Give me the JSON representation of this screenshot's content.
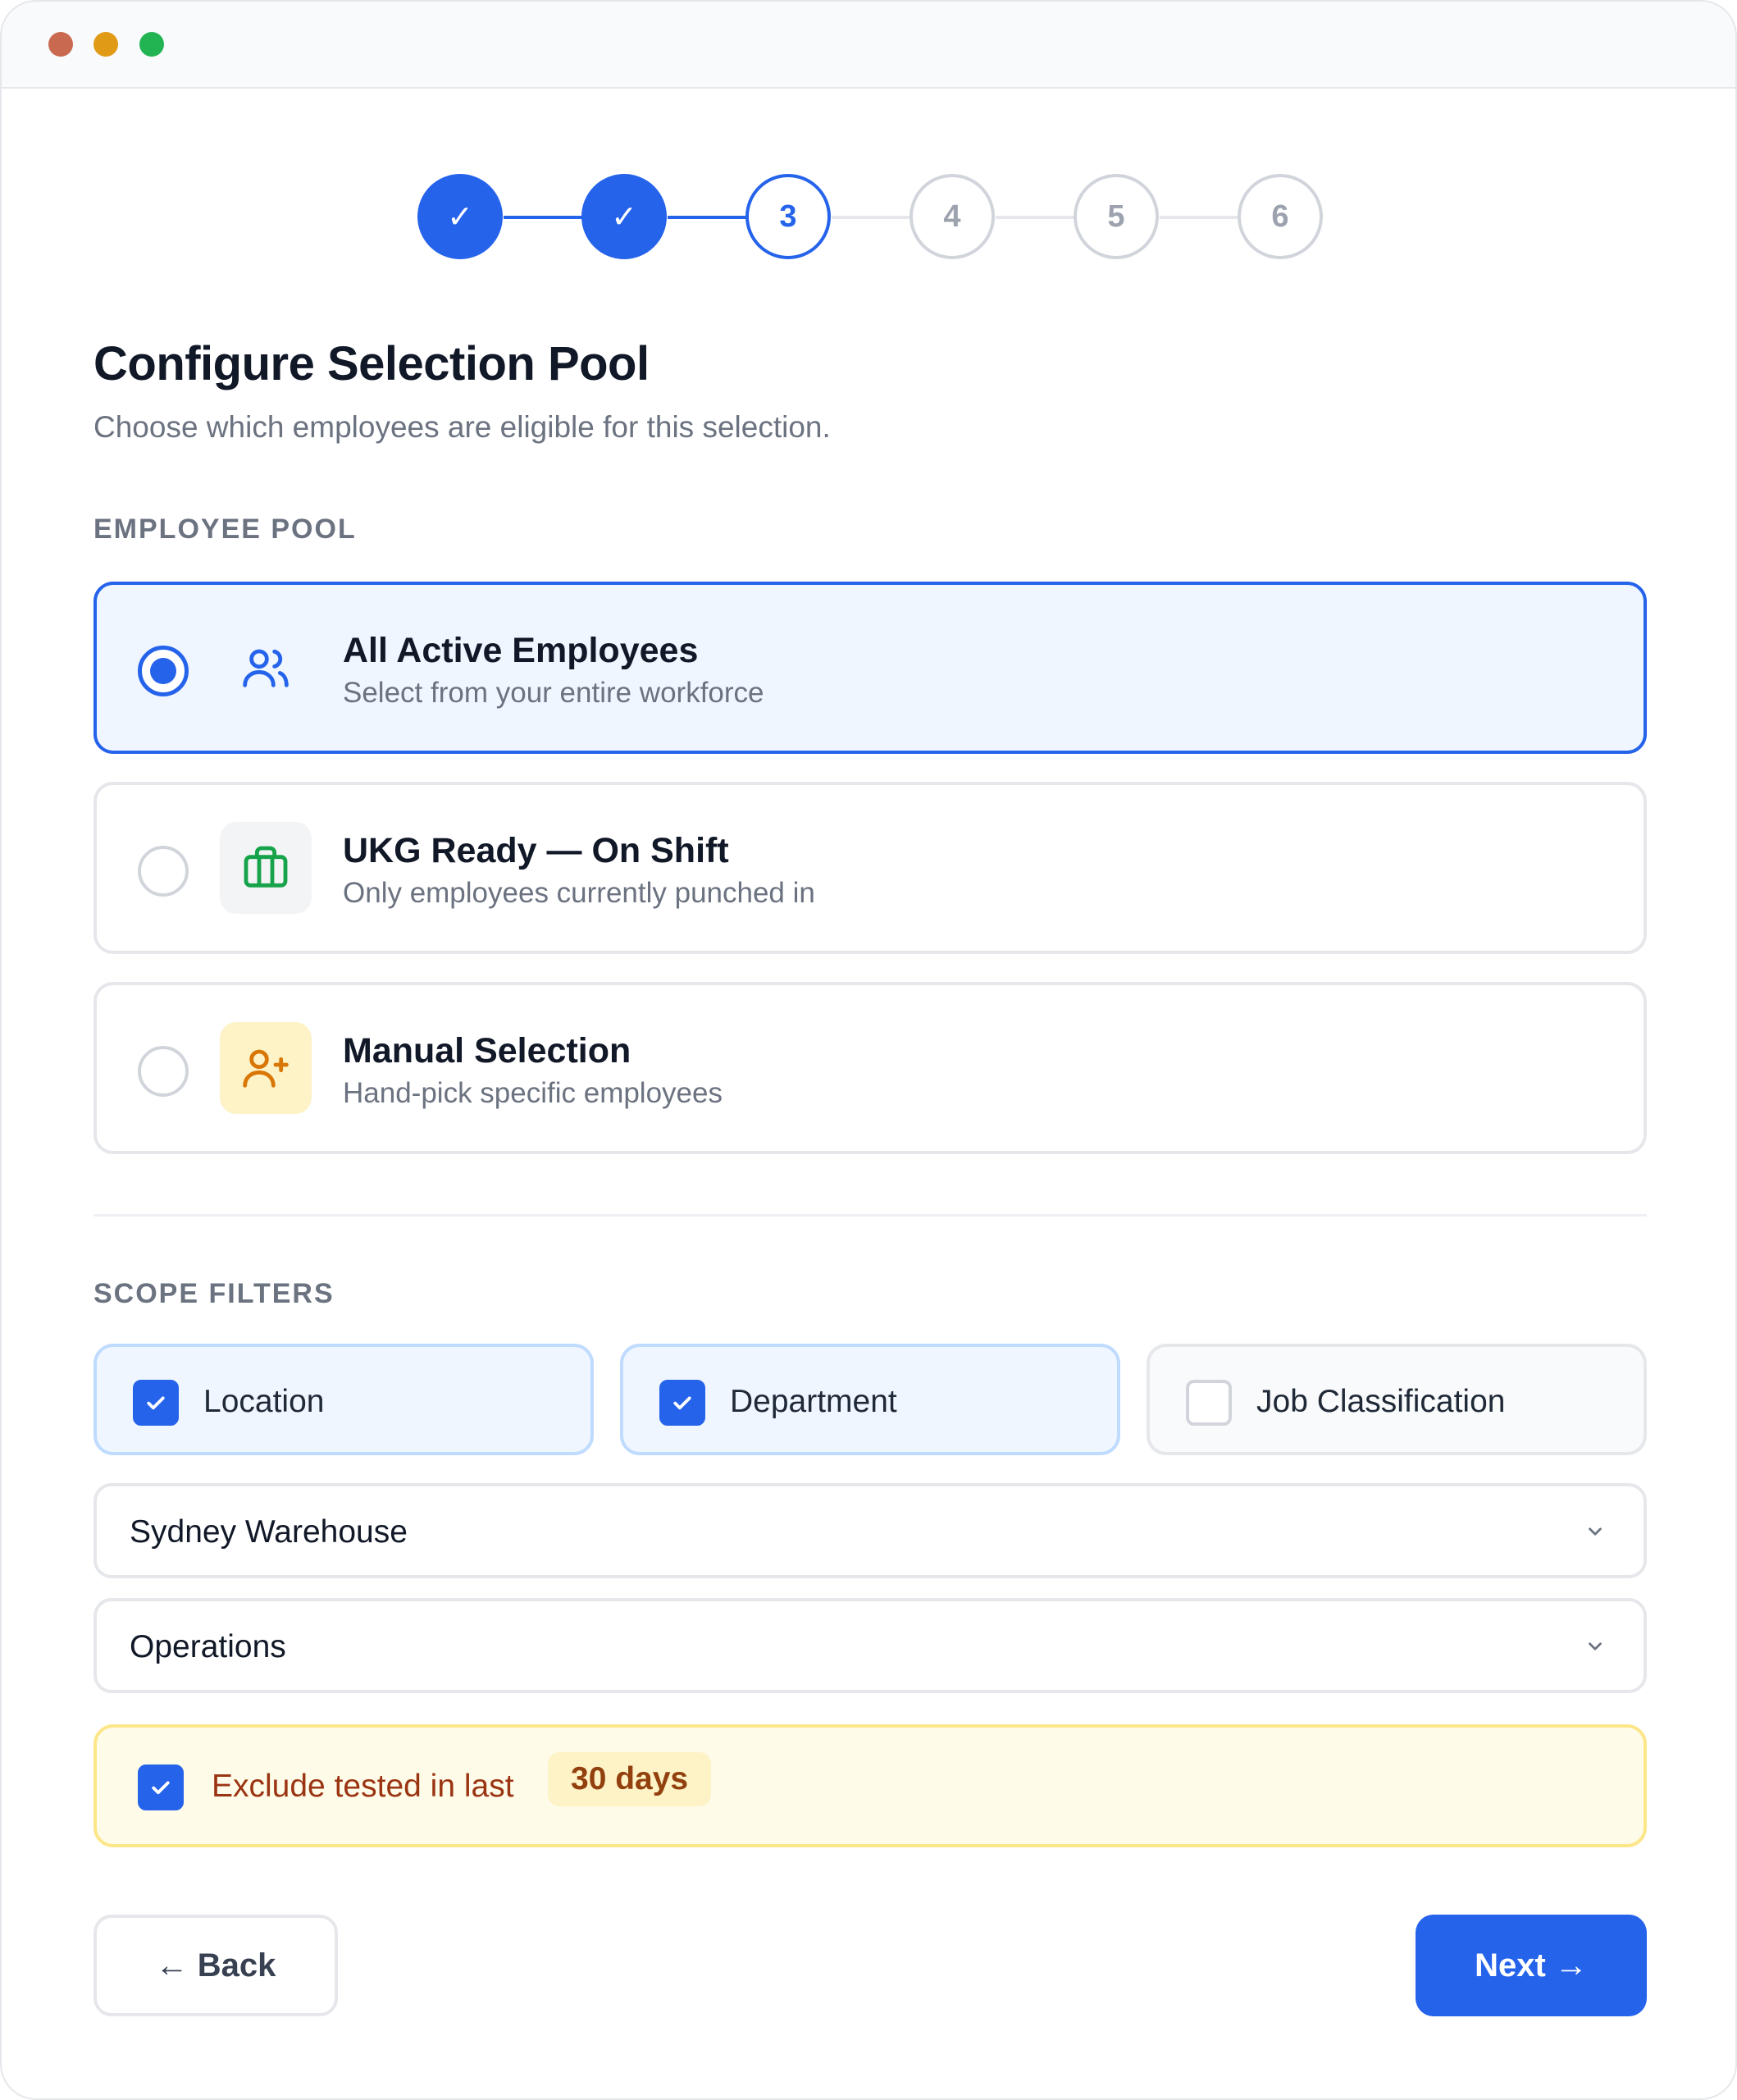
{
  "stepper": {
    "steps": [
      {
        "label": "✓",
        "state": "done"
      },
      {
        "label": "✓",
        "state": "done"
      },
      {
        "label": "3",
        "state": "current"
      },
      {
        "label": "4",
        "state": "pending"
      },
      {
        "label": "5",
        "state": "pending"
      },
      {
        "label": "6",
        "state": "pending"
      }
    ]
  },
  "header": {
    "title": "Configure Selection Pool",
    "subtitle": "Choose which employees are eligible for this selection."
  },
  "pool": {
    "section_label": "EMPLOYEE POOL",
    "selected": "All Active Employees",
    "options": [
      {
        "title": "All Active Employees",
        "description": "Select from your entire workforce",
        "icon": "users-icon"
      },
      {
        "title": "UKG Ready — On Shift",
        "description": "Only employees currently punched in",
        "icon": "briefcase-icon"
      },
      {
        "title": "Manual Selection",
        "description": "Hand-pick specific employees",
        "icon": "user-plus-icon"
      }
    ]
  },
  "scope": {
    "section_label": "SCOPE FILTERS",
    "filters": [
      {
        "label": "Location",
        "checked": true
      },
      {
        "label": "Department",
        "checked": true
      },
      {
        "label": "Job Classification",
        "checked": false
      }
    ],
    "location_select": {
      "value": "Sydney Warehouse"
    },
    "department_select": {
      "value": "Operations"
    }
  },
  "exclude": {
    "checked": true,
    "label": "Exclude tested in last",
    "days": "30 days"
  },
  "actions": {
    "back_label": "← Back",
    "next_label": "Next →"
  },
  "colors": {
    "accent": "#2563eb",
    "warning_bg": "#fefce8",
    "warning_text": "#9a3412",
    "success_icon": "#16a34a",
    "amber_icon": "#d97706"
  }
}
